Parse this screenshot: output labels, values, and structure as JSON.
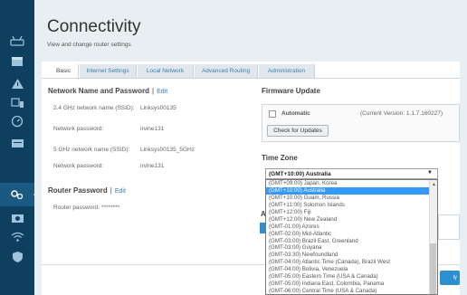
{
  "header": {
    "title": "Connectivity",
    "subtitle": "View and change router settings"
  },
  "tabs": [
    {
      "label": "Basic",
      "active": true
    },
    {
      "label": "Internet Settings",
      "active": false
    },
    {
      "label": "Local Network",
      "active": false
    },
    {
      "label": "Advanced Routing",
      "active": false
    },
    {
      "label": "Administration",
      "active": false
    }
  ],
  "network": {
    "title": "Network Name and Password",
    "edit": "Edit",
    "separator": "|",
    "fields": [
      {
        "label": "2.4 GHz network name (SSID):",
        "value": "Linksys00135"
      },
      {
        "label": "Network password:",
        "value": "irvine131"
      },
      {
        "label": "5 GHz network name (SSID):",
        "value": "Linksys00135_5GHz"
      },
      {
        "label": "Network password:",
        "value": "irvine131"
      }
    ]
  },
  "router_password": {
    "title": "Router Password",
    "edit": "Edit",
    "separator": "|",
    "label": "Router password:",
    "value": "********"
  },
  "firmware": {
    "title": "Firmware Update",
    "automatic_label": "Automatic",
    "automatic_checked": false,
    "version": "(Current Version: 1.1.7.160227)",
    "check_button": "Check for Updates"
  },
  "timezone": {
    "title": "Time Zone",
    "selected": "(GMT+10:00) Australia",
    "options": [
      "(GMT+09:00) Japan, Korea",
      "(GMT+10:00) Australia",
      "(GMT+10:00) Guam, Russia",
      "(GMT+11:00) Solomon Islands",
      "(GMT+12:00) Fiji",
      "(GMT+12:00) New Zealand",
      "(GMT-01:00) Azores",
      "(GMT-02:00) Mid-Atlantic",
      "(GMT-03:00) Brazil East, Greenland",
      "(GMT-03:00) Guyana",
      "(GMT-03:30) Newfoundland",
      "(GMT-04:00) Atlantic Time (Canada), Brazil West",
      "(GMT-04:00) Bolivia, Venezuela",
      "(GMT-05:00) Eastern Time (USA & Canada)",
      "(GMT-05:00) Indiana East, Colombia, Panama",
      "(GMT-06:00) Central Time (USA & Canada)"
    ],
    "selected_index": 1
  },
  "partial": {
    "letter": "A",
    "button_text": "ly"
  },
  "colors": {
    "sidebar": "#0e3f5f",
    "accent": "#3a7fb0",
    "selection": "#3399ff"
  }
}
